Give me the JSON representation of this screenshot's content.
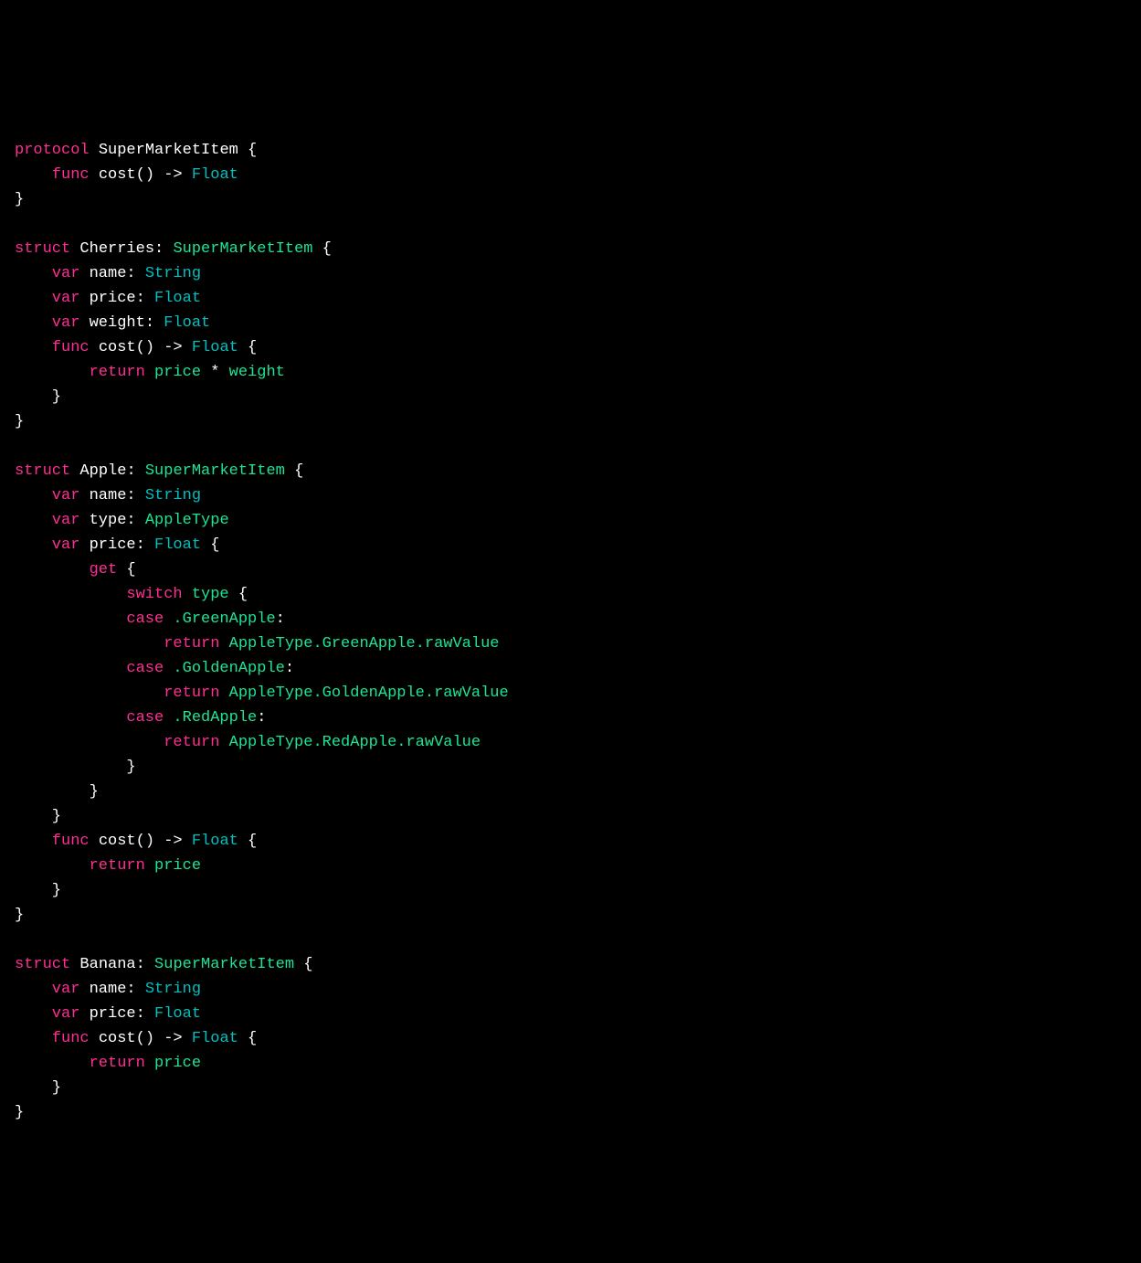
{
  "code": {
    "kw_protocol": "protocol",
    "kw_struct": "struct",
    "kw_func": "func",
    "kw_var": "var",
    "kw_return": "return",
    "kw_get": "get",
    "kw_switch": "switch",
    "kw_case": "case",
    "type_Float": "Float",
    "type_String": "String",
    "type_AppleType": "AppleType",
    "name_SuperMarketItem": "SuperMarketItem",
    "name_Cherries": "Cherries",
    "name_Apple": "Apple",
    "name_Banana": "Banana",
    "field_name": "name",
    "field_price": "price",
    "field_weight": "weight",
    "field_type": "type",
    "expr_price_times_weight_a": "price",
    "expr_price_times_weight_op": " * ",
    "expr_price_times_weight_b": "weight",
    "cost_sig_name": "cost",
    "cost_sig_parens": "()",
    "arrow": " -> ",
    "obrace": " {",
    "cbrace": "}",
    "colon_sp": ": ",
    "case_GreenApple_dot": ".GreenApple",
    "case_GoldenApple_dot": ".GoldenApple",
    "case_RedApple_dot": ".RedApple",
    "green_rv": "AppleType.GreenApple.rawValue",
    "golden_rv": "AppleType.GoldenApple.rawValue",
    "red_rv": "AppleType.RedApple.rawValue",
    "switch_subject": "type"
  }
}
